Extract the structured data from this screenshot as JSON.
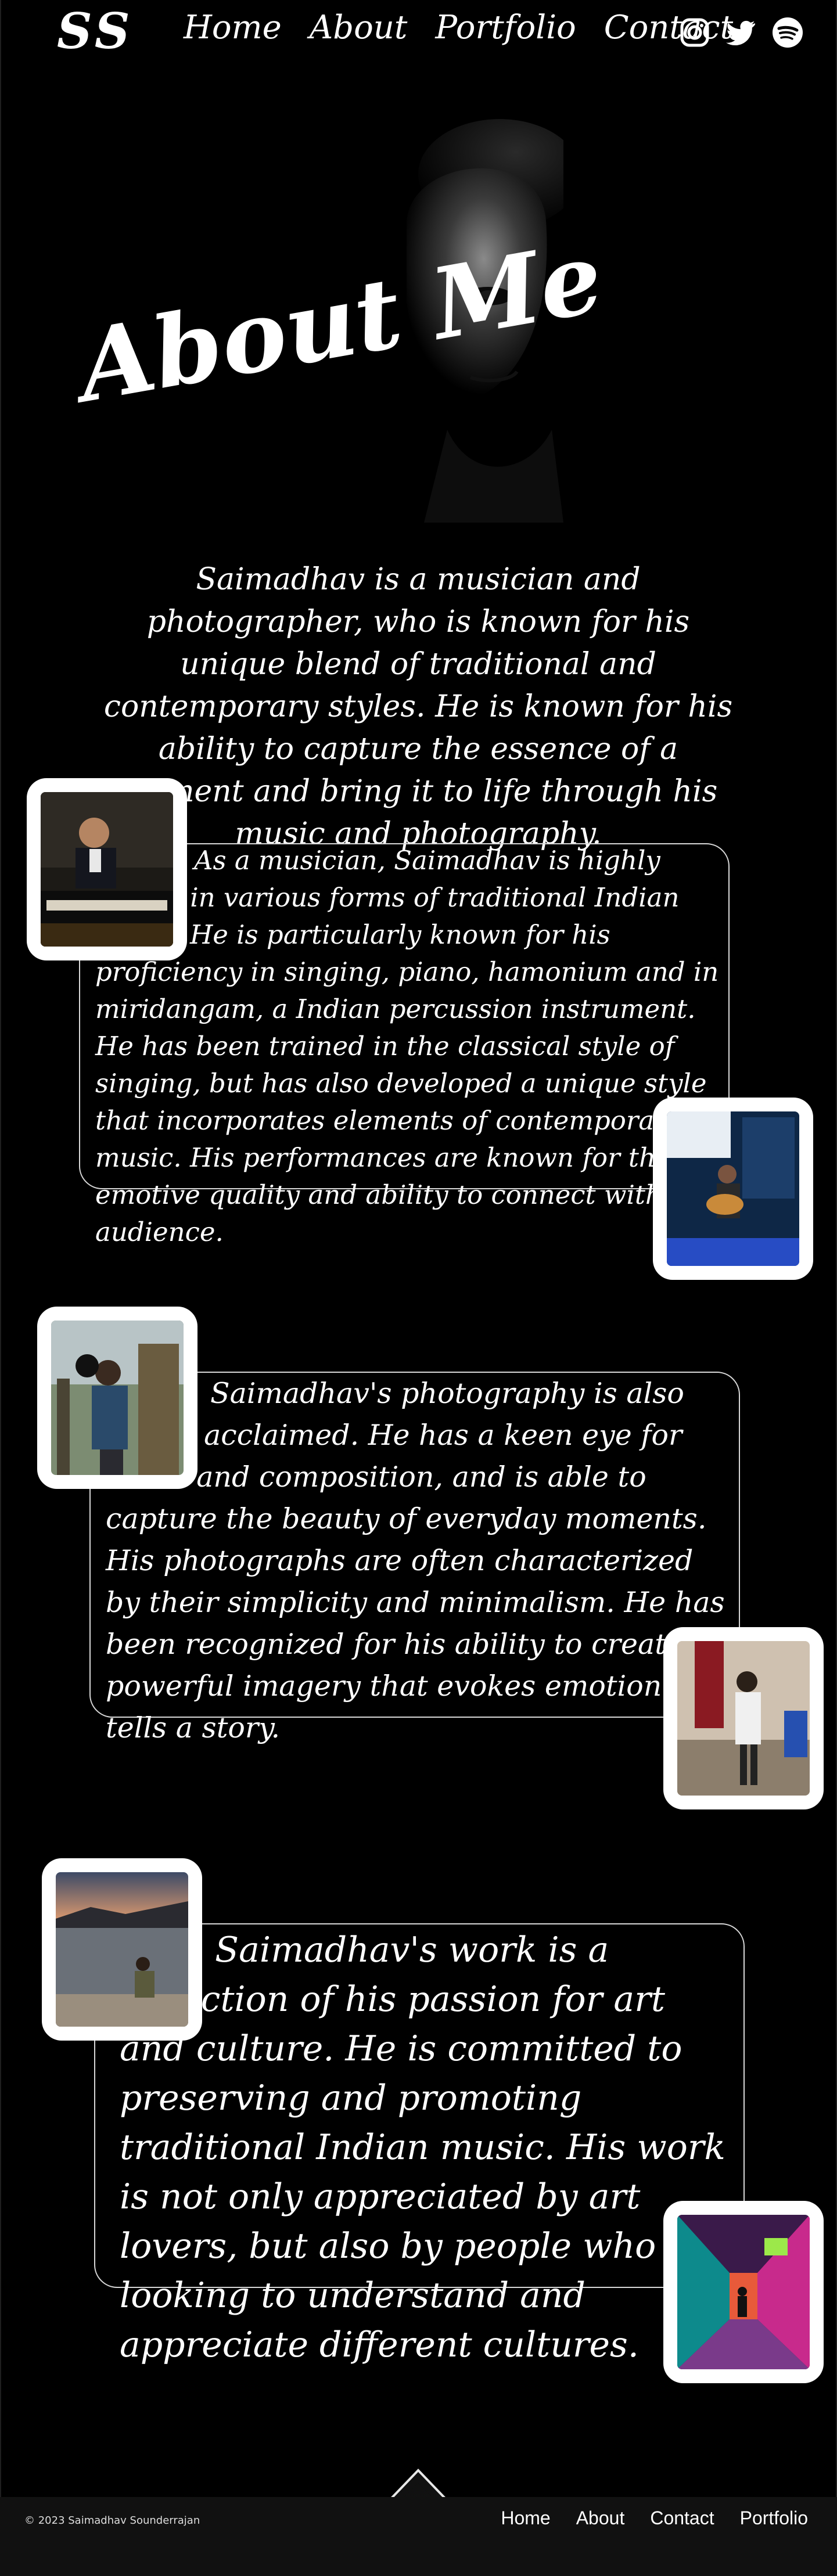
{
  "header": {
    "logo": "SS",
    "nav": [
      "Home",
      "About",
      "Portfolio",
      "Contact"
    ],
    "social": [
      "instagram-icon",
      "twitter-icon",
      "spotify-icon"
    ]
  },
  "hero": {
    "heading": "About Me",
    "intro": "Saimadhav is a musician and photographer, who is known for his unique blend of traditional and contemporary styles. He is known for his ability to capture the essence of a moment and bring it to life through his music and photography."
  },
  "sections": [
    {
      "text": "As a musician, Saimadhav is highly skilled in various forms of traditional Indian music. He is particularly known for his proficiency in singing, piano, hamonium and in miridangam, a Indian percussion instrument.  He has been trained in the classical style of singing, but has also developed a unique style that incorporates elements of contemporary music. His performances are known for their emotive quality and ability to connect with the audience."
    },
    {
      "text": "Saimadhav's photography is also highly acclaimed. He has a keen eye for detail and composition, and is able to capture the beauty of everyday moments. His photographs are often characterized by their simplicity and minimalism. He has been recognized for his ability to create powerful imagery that evokes emotion and tells a story."
    },
    {
      "text": "Saimadhav's work is a reflection of his passion for art and culture. He is committed to preserving and promoting traditional Indian music. His work is not only appreciated by art lovers, but also by people who are looking to understand and appreciate different cultures."
    }
  ],
  "footer": {
    "copyright": "© 2023 Saimadhav Sounderrajan",
    "links": [
      "Home",
      "About",
      "Contact",
      "Portfolio"
    ]
  },
  "colors": {
    "background": "#000000",
    "text": "#ffffff",
    "footer": "#111111"
  }
}
